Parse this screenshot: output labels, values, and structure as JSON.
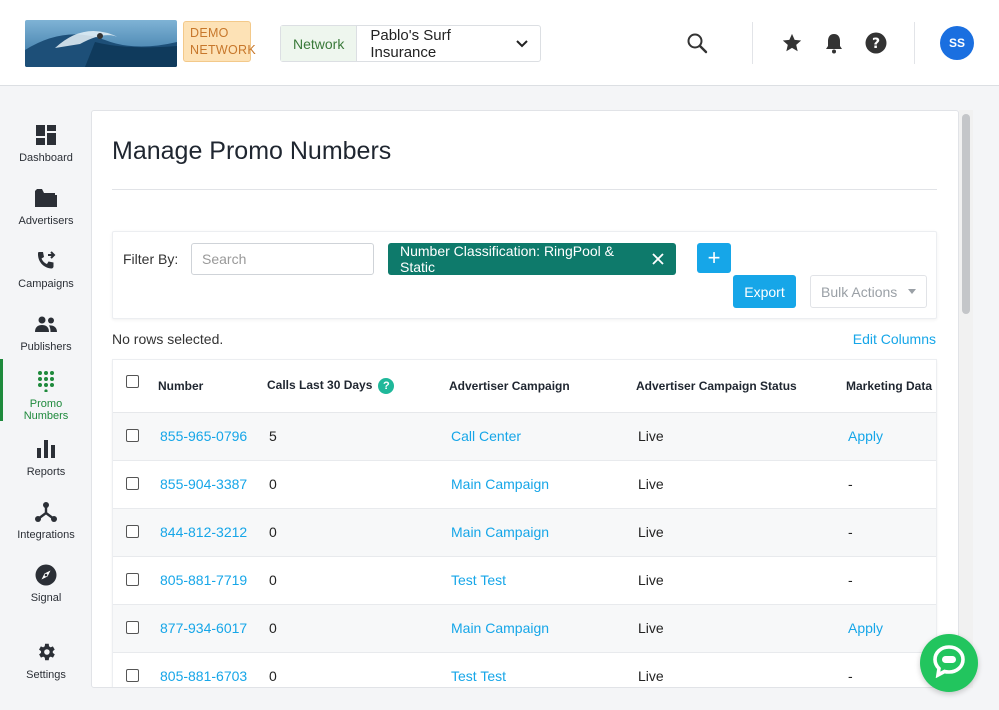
{
  "header": {
    "demo_badge": "DEMO NETWORK",
    "network_label": "Network",
    "network_value": "Pablo's Surf Insurance",
    "avatar_initials": "SS"
  },
  "sidebar": {
    "items": [
      {
        "label": "Dashboard",
        "icon": "dashboard-icon"
      },
      {
        "label": "Advertisers",
        "icon": "folder-icon"
      },
      {
        "label": "Campaigns",
        "icon": "phone-forward-icon"
      },
      {
        "label": "Publishers",
        "icon": "people-icon"
      },
      {
        "label": "Promo Numbers",
        "icon": "dial-pad-icon",
        "active": true
      },
      {
        "label": "Reports",
        "icon": "bar-chart-icon"
      },
      {
        "label": "Integrations",
        "icon": "integrations-icon"
      },
      {
        "label": "Signal",
        "icon": "compass-icon"
      },
      {
        "label": "Settings",
        "icon": "gear-icon"
      }
    ]
  },
  "main": {
    "title": "Manage Promo Numbers",
    "filter": {
      "label": "Filter By:",
      "search_placeholder": "Search",
      "chip": "Number Classification: RingPool & Static",
      "add_label": "+",
      "export_label": "Export",
      "bulk_label": "Bulk Actions"
    },
    "rows_selected": "No rows selected.",
    "edit_columns": "Edit Columns",
    "table": {
      "headers": [
        "Number",
        "Calls Last 30 Days",
        "Advertiser Campaign",
        "Advertiser Campaign Status",
        "Marketing Data"
      ],
      "help_glyph": "?",
      "rows": [
        {
          "number": "855-965-0796",
          "calls": "5",
          "campaign": "Call Center",
          "status": "Live",
          "marketing": "Apply"
        },
        {
          "number": "855-904-3387",
          "calls": "0",
          "campaign": "Main Campaign",
          "status": "Live",
          "marketing": "-"
        },
        {
          "number": "844-812-3212",
          "calls": "0",
          "campaign": "Main Campaign",
          "status": "Live",
          "marketing": "-"
        },
        {
          "number": "805-881-7719",
          "calls": "0",
          "campaign": "Test Test",
          "status": "Live",
          "marketing": "-"
        },
        {
          "number": "877-934-6017",
          "calls": "0",
          "campaign": "Main Campaign",
          "status": "Live",
          "marketing": "Apply"
        },
        {
          "number": "805-881-6703",
          "calls": "0",
          "campaign": "Test Test",
          "status": "Live",
          "marketing": "-"
        }
      ]
    }
  },
  "colors": {
    "accent": "#16a6e8",
    "chip": "#0e7a6b",
    "active_nav": "#1e8a3c",
    "chat": "#22c55e"
  }
}
